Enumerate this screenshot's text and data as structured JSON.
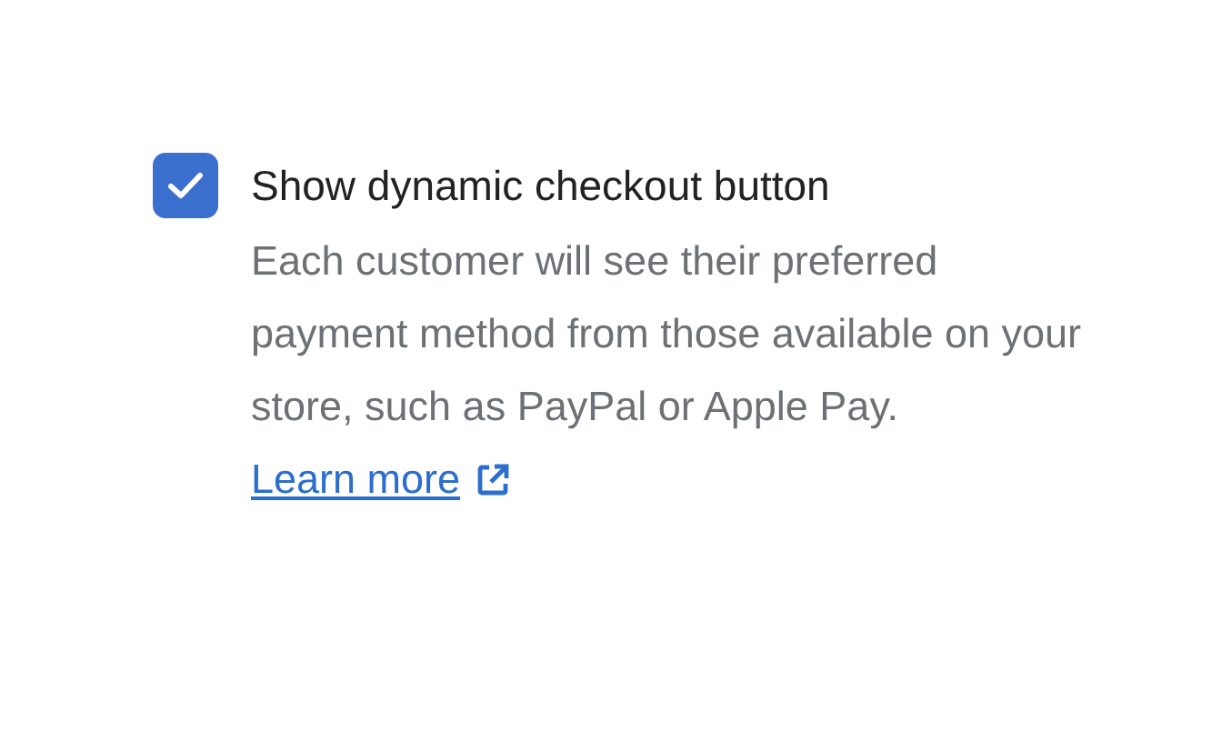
{
  "option": {
    "label": "Show dynamic checkout button",
    "checked": true,
    "description": "Each customer will see their preferred payment method from those available on your store, such as PayPal or Apple Pay.",
    "link": "Learn more"
  }
}
